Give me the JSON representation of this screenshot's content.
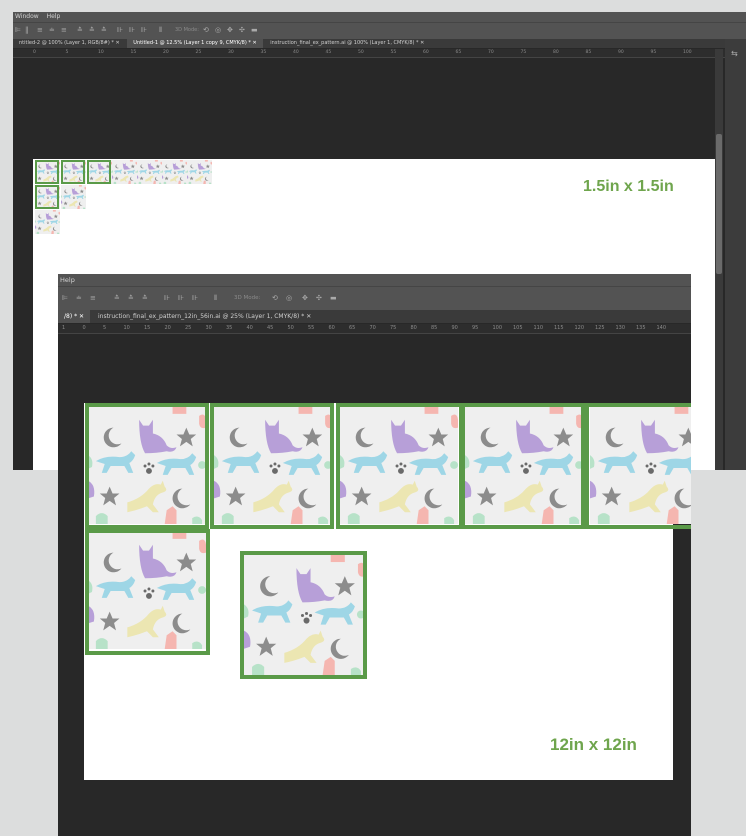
{
  "window1": {
    "menu": [
      "Window",
      "Help"
    ],
    "tabs": [
      {
        "label": "ntitled-2 @ 100% (Layer 1, RGB/8#) *",
        "active": false
      },
      {
        "label": "Untitled-1 @ 12.5% (Layer 1 copy 9, CMYK/8) *",
        "active": true
      },
      {
        "label": "instruction_final_ex_pattern.ai @ 100% (Layer 1, CMYK/8) *",
        "active": false
      }
    ],
    "ruler_ticks": [
      "0",
      "5",
      "10",
      "15",
      "20",
      "25",
      "30",
      "35",
      "40",
      "45",
      "50",
      "55",
      "60",
      "65",
      "70",
      "75",
      "80",
      "85",
      "90",
      "95",
      "100"
    ],
    "label": "1.5in x 1.5in",
    "toolbar_mode": "3D Mode:"
  },
  "window2": {
    "menu": [
      "Help"
    ],
    "tabs": [
      {
        "label": "/8) *",
        "active": true
      },
      {
        "label": "instruction_final_ex_pattern_12in_56in.ai @ 25% (Layer 1, CMYK/8) *",
        "active": false
      }
    ],
    "ruler_ticks": [
      "1",
      "0",
      "5",
      "10",
      "15",
      "20",
      "25",
      "30",
      "35",
      "40",
      "45",
      "50",
      "55",
      "60",
      "65",
      "70",
      "75",
      "80",
      "85",
      "90",
      "95",
      "100",
      "105",
      "110",
      "115",
      "120",
      "125",
      "130",
      "135",
      "140"
    ],
    "label": "12in x 12in",
    "toolbar_mode": "3D Mode:"
  },
  "pattern": {
    "icons": [
      "moon-icon",
      "cat-sitting-icon",
      "star-icon",
      "cat-walking-icon",
      "paw-icon",
      "cat-running-icon"
    ]
  },
  "colors": {
    "frame_green": "#5a9a48",
    "label_green": "#6fa54d",
    "app_dark": "#282828",
    "app_chrome": "#535353",
    "tile_bg": "#efefef",
    "cat_purple": "#b79fd8",
    "cat_blue": "#9ed6e6",
    "cat_yellow": "#ece6b2",
    "cat_pink": "#f5b6b0",
    "paw_green": "#b7e2c8"
  }
}
